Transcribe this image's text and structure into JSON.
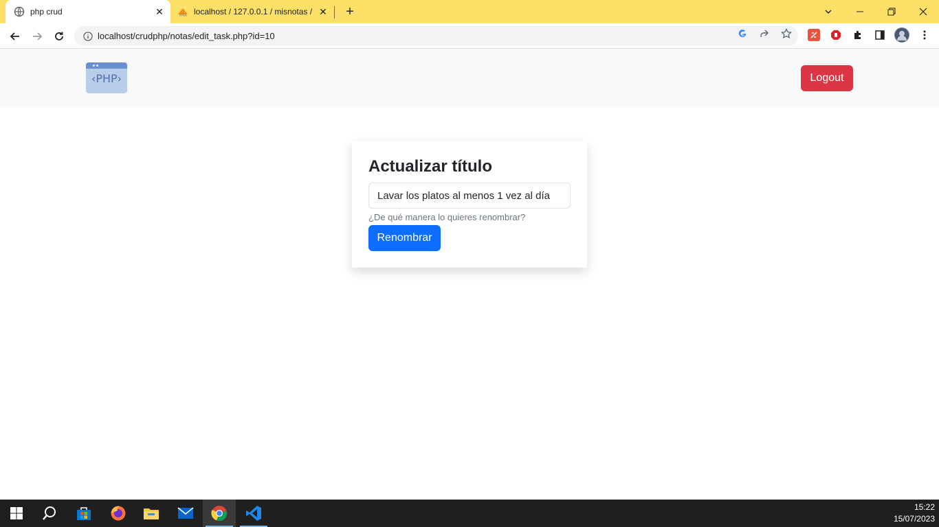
{
  "browser": {
    "tabs": [
      {
        "title": "php crud",
        "active": true
      },
      {
        "title": "localhost / 127.0.0.1 / misnotas /",
        "active": false
      }
    ],
    "url": "localhost/crudphp/notas/edit_task.php?id=10",
    "accent_color": "#fde068"
  },
  "navbar": {
    "logo_text": "‹PHP›",
    "logout_label": "Logout",
    "logout_color": "#dc3545"
  },
  "form": {
    "title": "Actualizar título",
    "input_value": "Lavar los platos al menos 1 vez al día",
    "help_text": "¿De qué manera lo quieres renombrar?",
    "submit_label": "Renombrar",
    "submit_color": "#0d6efd"
  },
  "taskbar": {
    "items": [
      "start-icon",
      "search-icon",
      "store-icon",
      "firefox-icon",
      "file-explorer-icon",
      "mail-icon",
      "chrome-icon",
      "vscode-icon"
    ],
    "active_item": "chrome-icon",
    "time": "15:22",
    "date": "15/07/2023"
  }
}
